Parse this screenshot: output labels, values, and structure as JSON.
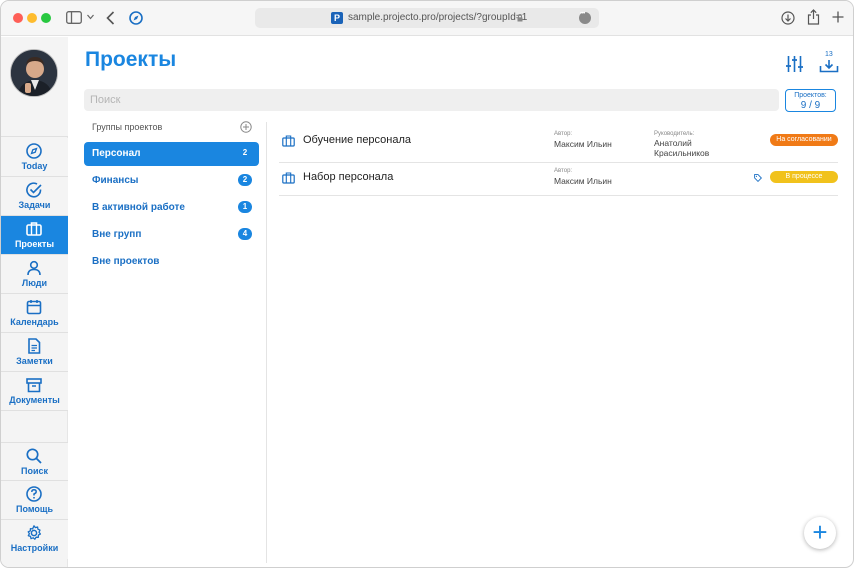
{
  "browser": {
    "url": "sample.projecto.pro/projects/?groupId=1",
    "favicon_letter": "P"
  },
  "sidebar": {
    "items": [
      {
        "label": "Today",
        "icon": "compass-icon"
      },
      {
        "label": "Задачи",
        "icon": "check-circle-icon"
      },
      {
        "label": "Проекты",
        "icon": "briefcase-icon",
        "active": true
      },
      {
        "label": "Люди",
        "icon": "person-icon"
      },
      {
        "label": "Календарь",
        "icon": "calendar-icon"
      },
      {
        "label": "Заметки",
        "icon": "note-icon"
      },
      {
        "label": "Документы",
        "icon": "archive-icon"
      }
    ],
    "bottom_items": [
      {
        "label": "Поиск",
        "icon": "search-icon"
      },
      {
        "label": "Помощь",
        "icon": "help-icon"
      },
      {
        "label": "Настройки",
        "icon": "gear-icon"
      }
    ]
  },
  "main": {
    "title": "Проекты",
    "download_count": "13",
    "search_placeholder": "Поиск",
    "project_count": {
      "label": "Проектов:",
      "value": "9 / 9"
    }
  },
  "groups": {
    "header": "Группы проектов",
    "items": [
      {
        "label": "Персонал",
        "count": "2",
        "active": true
      },
      {
        "label": "Финансы",
        "count": "2"
      },
      {
        "label": "В активной работе",
        "count": "1"
      },
      {
        "label": "Вне групп",
        "count": "4"
      },
      {
        "label": "Вне проектов",
        "count": ""
      }
    ]
  },
  "projects": [
    {
      "name": "Обучение персонала",
      "author_label": "Автор:",
      "author": "Максим Ильин",
      "manager_label": "Руководитель:",
      "manager": "Анатолий Красильников",
      "status": "На согласовании",
      "status_color": "#f07a16"
    },
    {
      "name": "Набор персонала",
      "author_label": "Автор:",
      "author": "Максим Ильин",
      "manager_label": "",
      "manager": "",
      "status": "В процессе",
      "status_color": "#f1c21c"
    }
  ],
  "colors": {
    "accent": "#1a86e0",
    "accent_dark": "#1a6fc4"
  }
}
